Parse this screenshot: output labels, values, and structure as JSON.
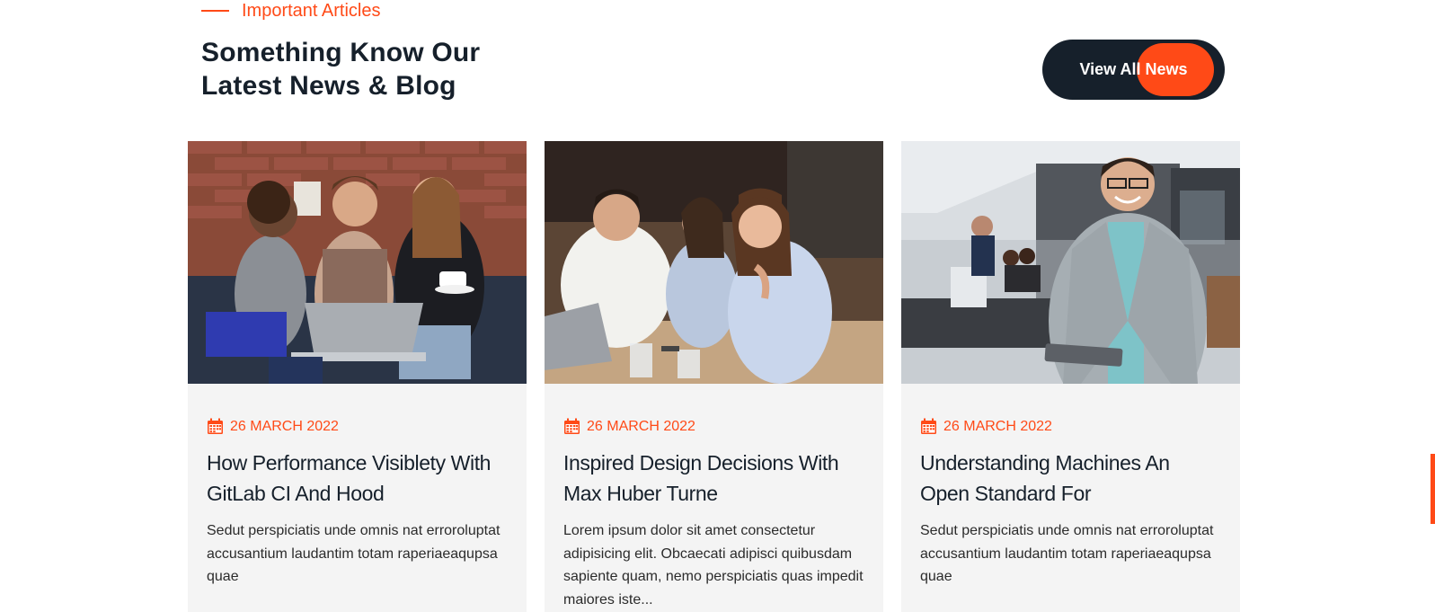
{
  "section": {
    "subtitle": "Important Articles",
    "heading_line1": "Something Know Our",
    "heading_line2": "Latest News & Blog",
    "view_all_label": "View All News"
  },
  "colors": {
    "accent": "#ff4a17",
    "dark": "#16202b",
    "card_bg": "#f4f4f4"
  },
  "cards": [
    {
      "date": "26 MARCH 2022",
      "title": "How Performance Visiblety With GitLab CI And Hood",
      "text": "Sedut perspiciatis unde omnis nat erroroluptat accusantium laudantim totam raperiaeaqupsa quae",
      "image_icon": "team-laptop-photo"
    },
    {
      "date": "26 MARCH 2022",
      "title": "Inspired Design Decisions With Max Huber Turne",
      "text": "Lorem ipsum dolor sit amet consectetur adipisicing elit. Obcaecati adipisci quibusdam sapiente quam, nemo perspiciatis quas impedit maiores iste...",
      "image_icon": "office-meeting-photo"
    },
    {
      "date": "26 MARCH 2022",
      "title": "Understanding Machines An Open Standard For",
      "text": "Sedut perspiciatis unde omnis nat erroroluptat accusantium laudantim totam raperiaeaqupsa quae",
      "image_icon": "businessman-tablet-photo"
    }
  ]
}
